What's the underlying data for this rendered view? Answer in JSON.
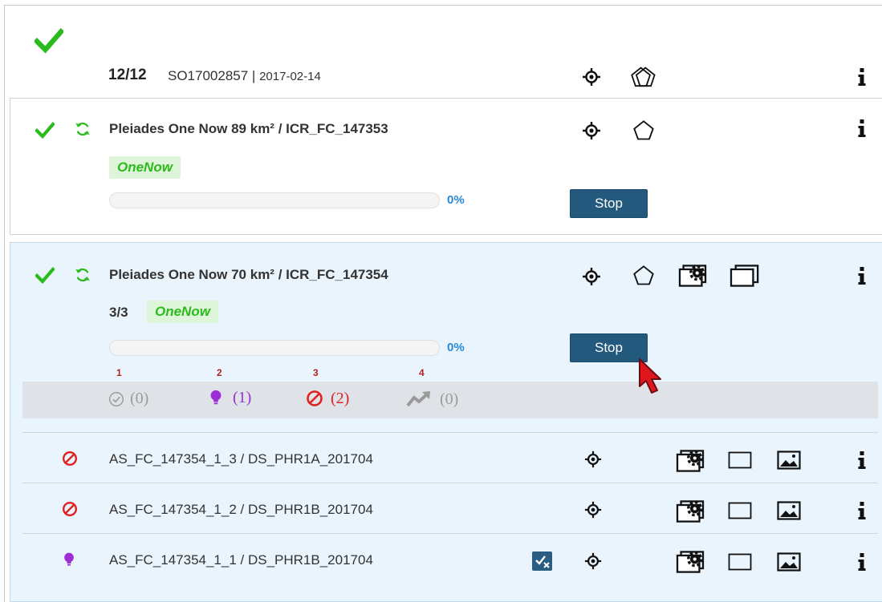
{
  "header": {
    "count": "12/12",
    "order_id": "SO17002857 |",
    "date": "2017-02-14"
  },
  "cards": [
    {
      "title": "Pleiades One Now 89 km² / ICR_FC_147353",
      "tag": "OneNow",
      "progress_value": 0,
      "progress_label": "0%",
      "button_label": "Stop"
    },
    {
      "title": "Pleiades One Now 70 km² / ICR_FC_147354",
      "fraction": "3/3",
      "tag": "OneNow",
      "progress_value": 0,
      "progress_label": "0%",
      "button_label": "Stop",
      "filters": [
        {
          "number": "1",
          "count": "(0)",
          "icon": "check-circle-icon",
          "color": "#9a9a9a"
        },
        {
          "number": "2",
          "count": "(1)",
          "icon": "lightbulb-icon",
          "color": "#9b2ed4"
        },
        {
          "number": "3",
          "count": "(2)",
          "icon": "prohibited-icon",
          "color": "#e02121"
        },
        {
          "number": "4",
          "count": "(0)",
          "icon": "trend-up-icon",
          "color": "#9a9a9a"
        }
      ],
      "rows": [
        {
          "status_icon": "prohibited-icon",
          "label": "AS_FC_147354_1_3 / DS_PHR1A_201704"
        },
        {
          "status_icon": "prohibited-icon",
          "label": "AS_FC_147354_1_2 / DS_PHR1B_201704"
        },
        {
          "status_icon": "lightbulb-icon",
          "label": "AS_FC_147354_1_1 / DS_PHR1B_201704"
        }
      ]
    }
  ],
  "colors": {
    "success": "#2cbb1d",
    "accent": "#24597e",
    "progress": "#2a8ad8",
    "error": "#e02121",
    "purple": "#9b2ed4",
    "selected_bg": "#e9f4fc"
  }
}
